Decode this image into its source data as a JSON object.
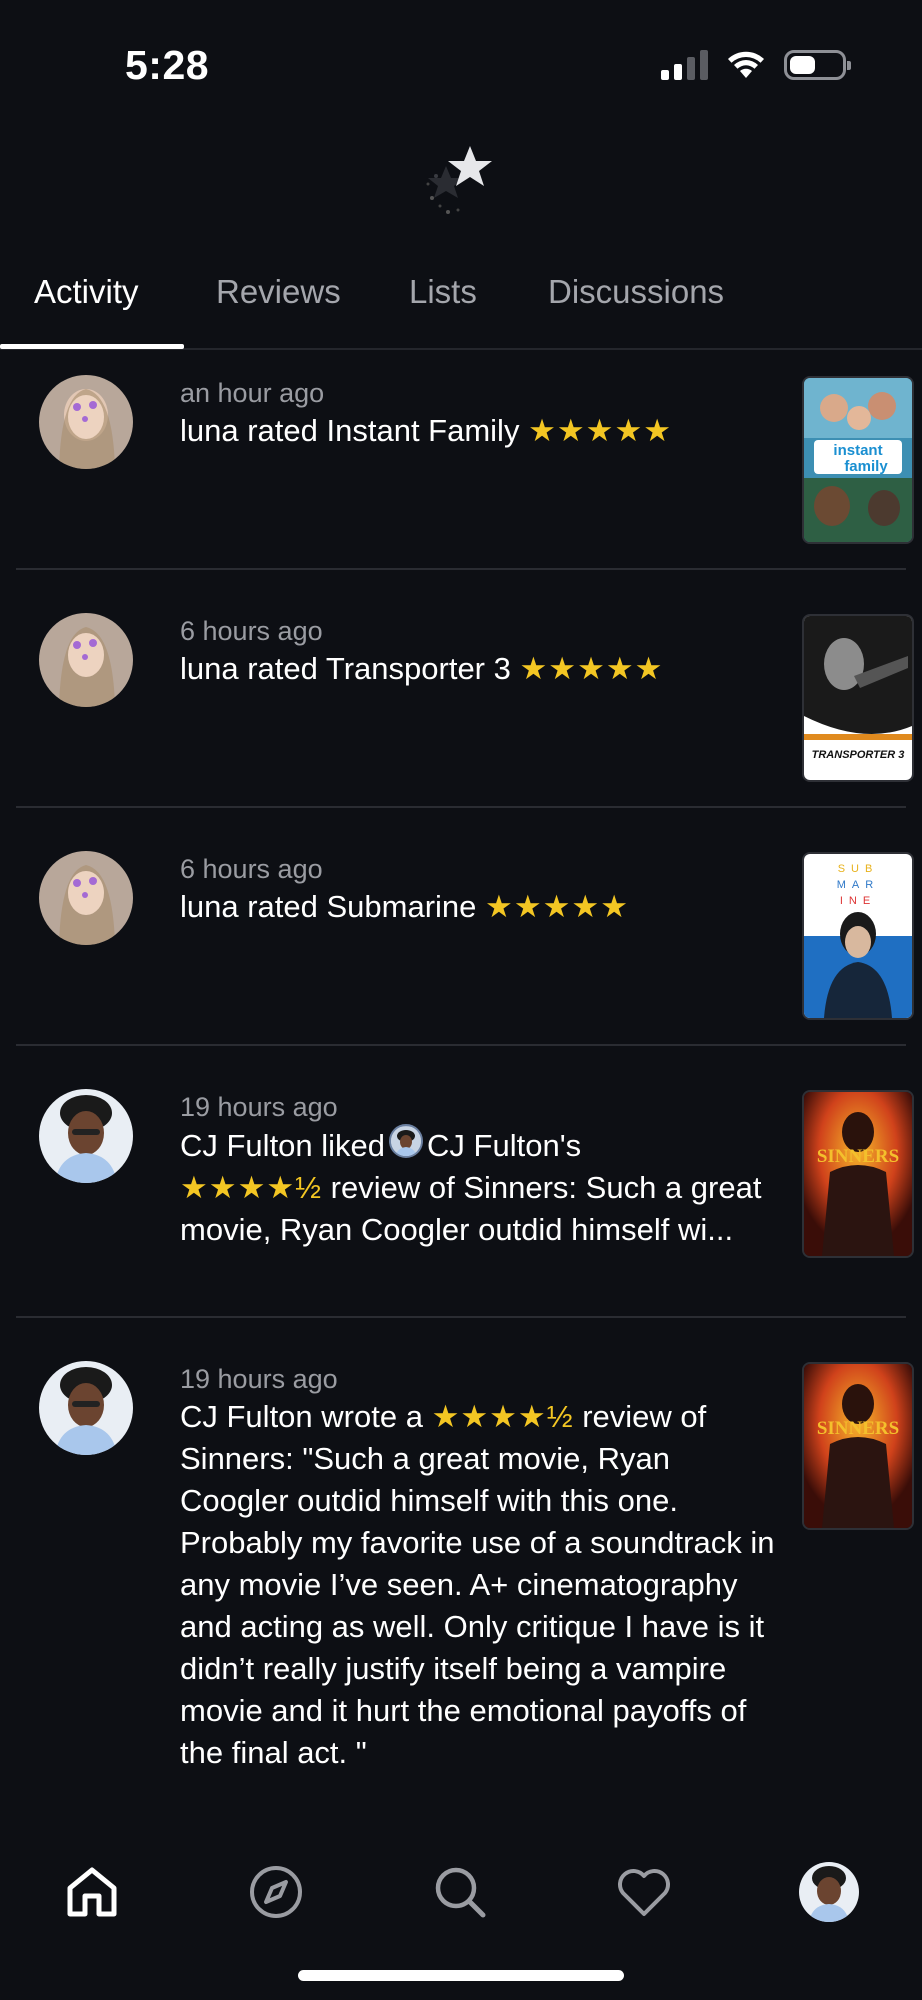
{
  "status_bar": {
    "time": "5:28",
    "icons": [
      "cellular-signal-icon",
      "wifi-icon",
      "battery-icon"
    ],
    "signal_bars": 2,
    "battery_level": 0.45
  },
  "app": {
    "logo_icon": "star-logo-icon"
  },
  "tabs": [
    {
      "label": "Activity",
      "active": true
    },
    {
      "label": "Reviews",
      "active": false
    },
    {
      "label": "Lists",
      "active": false
    },
    {
      "label": "Discussions",
      "active": false
    }
  ],
  "feed": [
    {
      "time": "an hour ago",
      "text": "luna rated Instant Family",
      "stars": "★★★★★",
      "poster_title": "instant family",
      "avatar": "user-avatar-luna"
    },
    {
      "time": "6 hours ago",
      "text": "luna rated Transporter 3",
      "stars": "★★★★★",
      "poster_title": "TRANSPORTER 3",
      "avatar": "user-avatar-luna"
    },
    {
      "time": "6 hours ago",
      "text": "luna rated Submarine",
      "stars": "★★★★★",
      "poster_title": "S U B M A R I N E",
      "avatar": "user-avatar-luna"
    },
    {
      "time": "19 hours ago",
      "text_before": "CJ Fulton liked",
      "text_after": "CJ Fulton's",
      "stars": "★★★★½",
      "text_rest": "review of Sinners: Such a great movie, Ryan Coogler outdid himself wi...",
      "poster_title": "SINNERS",
      "avatar": "user-avatar-cj"
    },
    {
      "time": "19 hours ago",
      "text_before": "CJ Fulton wrote a",
      "stars": "★★★★½",
      "text_rest": "review of Sinners: \"Such a great movie, Ryan Coogler outdid himself with this one. Probably my favorite use of a soundtrack in any movie I’ve seen. A+ cinematography and acting as well. Only critique I have is it didn’t really justify itself being a vampire movie and it hurt the emotional payoffs of the final act. \"",
      "poster_title": "SINNERS",
      "avatar": "user-avatar-cj"
    }
  ],
  "bottom_nav": [
    {
      "icon": "home-icon",
      "active": true
    },
    {
      "icon": "compass-icon",
      "active": false
    },
    {
      "icon": "search-icon",
      "active": false
    },
    {
      "icon": "heart-icon",
      "active": false
    },
    {
      "icon": "profile-avatar-icon",
      "active": false
    }
  ],
  "colors": {
    "background": "#0d0f14",
    "star": "#f3c623",
    "muted_text": "#9a9ca2"
  }
}
